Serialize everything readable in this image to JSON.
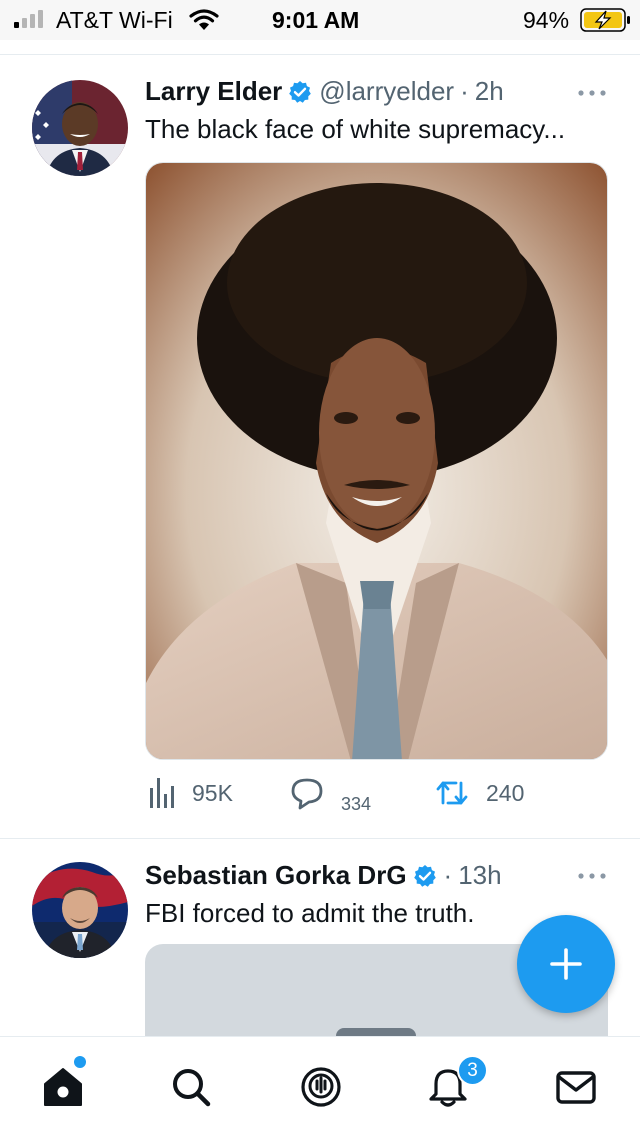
{
  "status_bar": {
    "carrier": "AT&T Wi-Fi",
    "time": "9:01 AM",
    "battery": "94%"
  },
  "tweets": [
    {
      "name": "Larry Elder",
      "handle": "@larryelder",
      "separator": "·",
      "time": "2h",
      "text": "The black face of white supremacy...",
      "views": "95K",
      "replies": "334",
      "retweets": "240"
    },
    {
      "name": "Sebastian Gorka DrG",
      "separator": "·",
      "time": "13h",
      "text": "FBI forced to admit the truth."
    }
  ],
  "tab_bar": {
    "notifications_badge": "3"
  },
  "colors": {
    "accent": "#1d9bf0",
    "text": "#0f1419",
    "secondary_text": "#536471",
    "retweet": "#1d9bf0"
  },
  "icons": [
    "cellular-signal-icon",
    "wifi-icon",
    "battery-charging-icon",
    "verified-badge-icon",
    "more-options-icon",
    "views-icon",
    "reply-icon",
    "retweet-icon",
    "compose-icon",
    "home-icon",
    "search-icon",
    "spaces-icon",
    "notifications-icon",
    "messages-icon"
  ]
}
